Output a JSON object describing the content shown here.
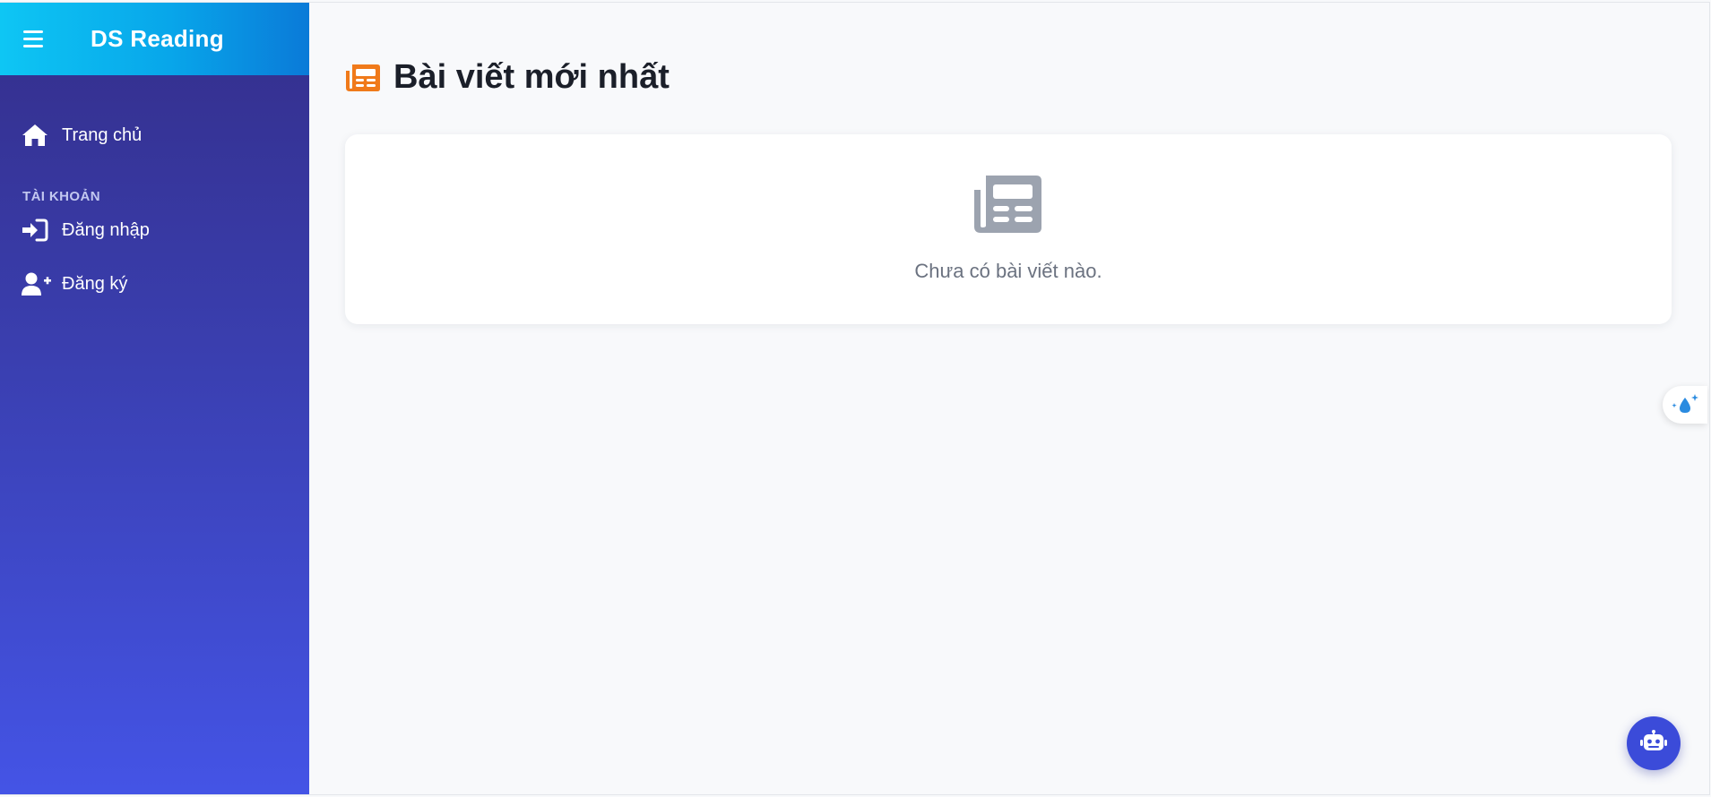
{
  "app": {
    "brand": "DS Reading"
  },
  "sidebar": {
    "items": [
      {
        "label": "Trang chủ",
        "icon": "home-icon"
      }
    ],
    "section_account": "TÀI KHOẢN",
    "account_items": [
      {
        "label": "Đăng nhập",
        "icon": "sign-in-icon"
      },
      {
        "label": "Đăng ký",
        "icon": "user-plus-icon"
      }
    ]
  },
  "main": {
    "title": "Bài viết mới nhất",
    "title_icon": "newspaper-icon",
    "empty_state": {
      "icon": "newspaper-icon",
      "message": "Chưa có bài viết nào."
    }
  },
  "floating": {
    "side_tab_icon": "sparkle-drop-icon",
    "chat_button_icon": "robot-icon"
  },
  "colors": {
    "accent_orange": "#f07a1a",
    "sidebar_top": "#342e8a",
    "sidebar_bottom": "#4454e6",
    "header_cyan": "#0ec6f4",
    "chat_button": "#3b4bd9"
  }
}
